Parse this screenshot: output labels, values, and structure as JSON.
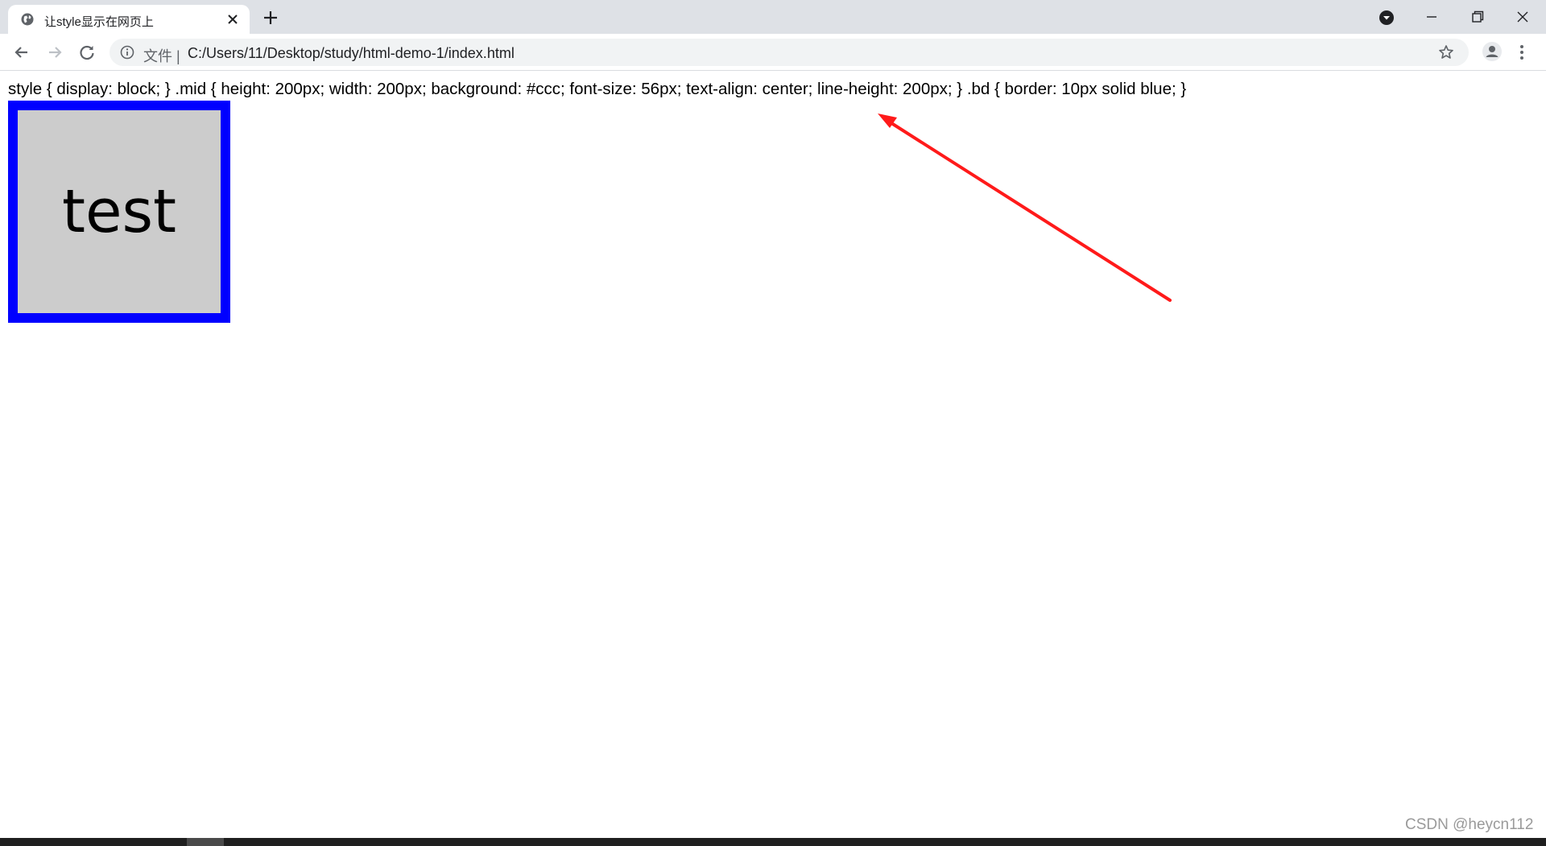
{
  "browser": {
    "tab": {
      "title": "让style显示在网页上",
      "favicon": "globe-icon",
      "close_icon": "close-icon"
    },
    "new_tab_icon": "plus-icon",
    "window_controls": [
      "minimize-icon",
      "maximize-icon",
      "close-icon"
    ],
    "toolbar": {
      "back_icon": "arrow-left-icon",
      "forward_icon": "arrow-right-icon",
      "reload_icon": "reload-icon",
      "info_icon": "info-icon",
      "url_scheme_label": "文件",
      "url": "C:/Users/11/Desktop/study/html-demo-1/index.html",
      "bookmark_icon": "star-icon",
      "account_icon": "account-icon",
      "menu_icon": "more-vert-icon"
    }
  },
  "page": {
    "style_text": "style { display: block; } .mid { height: 200px; width: 200px; background: #ccc; font-size: 56px; text-align: center; line-height: 200px; } .bd { border: 10px solid blue; }",
    "box_label": "test",
    "box_background": "#cccccc",
    "box_border_color": "#0000ff"
  },
  "annotation": {
    "arrow_color": "#ff1a1a"
  },
  "watermark": "CSDN @heycn112",
  "colors": {
    "tabstrip": "#dee1e6",
    "omnibox": "#f1f3f4",
    "taskbar": "#1f1f1f"
  }
}
